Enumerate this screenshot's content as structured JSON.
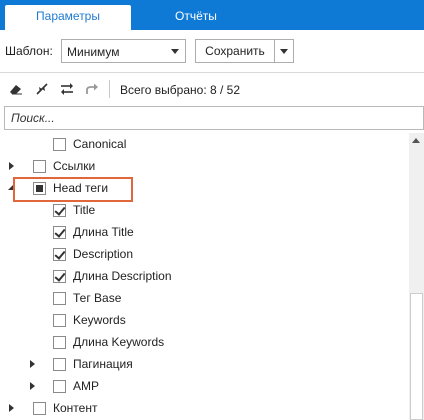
{
  "tabs": [
    {
      "label": "Параметры",
      "active": true
    },
    {
      "label": "Отчёты",
      "active": false
    }
  ],
  "toolbar": {
    "template_label": "Шаблон:",
    "template_value": "Минимум",
    "save_label": "Сохранить"
  },
  "actions": {
    "icons": [
      "eraser-icon",
      "collapse-icon",
      "swap-icon",
      "redo-icon"
    ],
    "total_label": "Всего выбрано: 8 / 52"
  },
  "search": {
    "placeholder": "Поиск..."
  },
  "tree": [
    {
      "label": "Canonical",
      "state": "unchecked",
      "expander": "none"
    },
    {
      "label": "Ссылки",
      "state": "unchecked",
      "expander": "collapsed"
    },
    {
      "label": "Head теги",
      "state": "partial",
      "expander": "expanded"
    },
    {
      "label": "Title",
      "state": "checked",
      "expander": "none"
    },
    {
      "label": "Длина Title",
      "state": "checked",
      "expander": "none"
    },
    {
      "label": "Description",
      "state": "checked",
      "expander": "none"
    },
    {
      "label": "Длина Description",
      "state": "checked",
      "expander": "none"
    },
    {
      "label": "Тег Base",
      "state": "unchecked",
      "expander": "none"
    },
    {
      "label": "Keywords",
      "state": "unchecked",
      "expander": "none"
    },
    {
      "label": "Длина Keywords",
      "state": "unchecked",
      "expander": "none"
    },
    {
      "label": "Пагинация",
      "state": "unchecked",
      "expander": "collapsed"
    },
    {
      "label": "AMP",
      "state": "unchecked",
      "expander": "collapsed"
    },
    {
      "label": "Контент",
      "state": "unchecked",
      "expander": "collapsed"
    }
  ],
  "colors": {
    "tab_bar": "#0f7ad6",
    "highlight": "#e0663b"
  }
}
